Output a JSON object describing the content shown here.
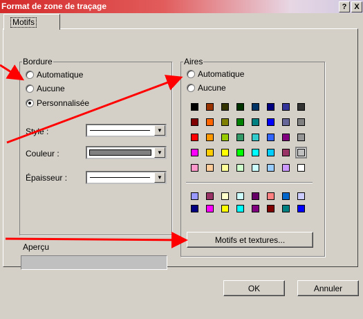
{
  "window": {
    "title": "Format de zone de traçage",
    "help_label": "?",
    "close_label": "X"
  },
  "tabs": [
    {
      "label": "Motifs"
    }
  ],
  "bordure": {
    "group_label": "Bordure",
    "options": [
      "Automatique",
      "Aucune",
      "Personnalisée"
    ],
    "selected": "Personnalisée",
    "style_label": "Style :",
    "couleur_label": "Couleur :",
    "epaisseur_label": "Épaisseur :"
  },
  "aires": {
    "group_label": "Aires",
    "options": [
      "Automatique",
      "Aucune"
    ],
    "motifs_button": "Motifs et textures..."
  },
  "apercu_label": "Aperçu",
  "footer": {
    "ok": "OK",
    "cancel": "Annuler"
  },
  "colors": {
    "dialog_bg": "#d4d0c8",
    "annotation_arrow": "#ff0000",
    "couleur_swatch": "#808080",
    "palette_main": [
      [
        "#000000",
        "#993300",
        "#333300",
        "#003300",
        "#003366",
        "#000080",
        "#333399",
        "#333333"
      ],
      [
        "#800000",
        "#ff6600",
        "#808000",
        "#008000",
        "#008080",
        "#0000ff",
        "#666699",
        "#808080"
      ],
      [
        "#ff0000",
        "#ff9900",
        "#99cc00",
        "#339966",
        "#33cccc",
        "#3366ff",
        "#800080",
        "#969696"
      ],
      [
        "#ff00ff",
        "#ffcc00",
        "#ffff00",
        "#00ff00",
        "#00ffff",
        "#00ccff",
        "#993366",
        "#c0c0c0"
      ],
      [
        "#ff99cc",
        "#ffcc99",
        "#ffff99",
        "#ccffcc",
        "#ccffff",
        "#99ccff",
        "#cc99ff",
        "#ffffff"
      ]
    ],
    "palette_extra": [
      [
        "#9999ff",
        "#993366",
        "#ffffcc",
        "#ccffff",
        "#660066",
        "#ff8080",
        "#0066cc",
        "#ccccff"
      ],
      [
        "#000080",
        "#ff00ff",
        "#ffff00",
        "#00ffff",
        "#800080",
        "#800000",
        "#008080",
        "#0000ff"
      ]
    ],
    "selected_swatch": "#c0c0c0"
  }
}
